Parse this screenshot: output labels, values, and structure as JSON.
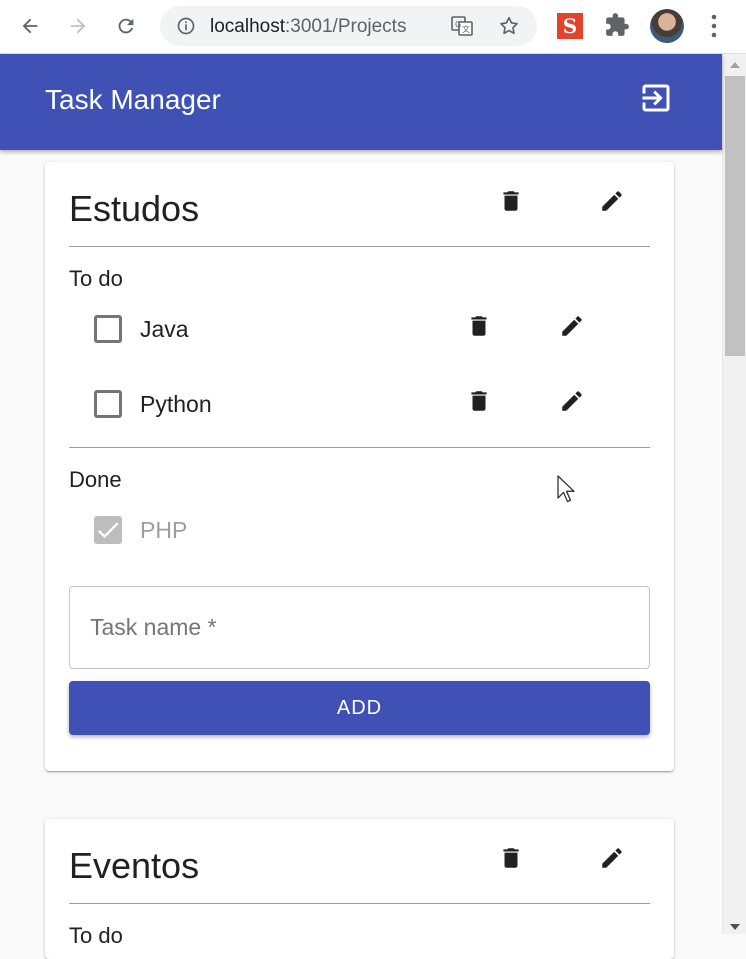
{
  "browser": {
    "url_host": "localhost",
    "url_path": ":3001/Projects",
    "extension_label": "S"
  },
  "app": {
    "title": "Task Manager"
  },
  "projects": [
    {
      "name": "Estudos",
      "todo_label": "To do",
      "todo": [
        {
          "name": "Java",
          "done": false
        },
        {
          "name": "Python",
          "done": false
        }
      ],
      "done_label": "Done",
      "done": [
        {
          "name": "PHP",
          "done": true
        }
      ],
      "task_input_placeholder": "Task name *",
      "add_label": "ADD"
    },
    {
      "name": "Eventos",
      "todo_label": "To do"
    }
  ],
  "colors": {
    "primary": "#3f51b5",
    "icon": "#212121",
    "disabled": "#9e9e9e"
  }
}
